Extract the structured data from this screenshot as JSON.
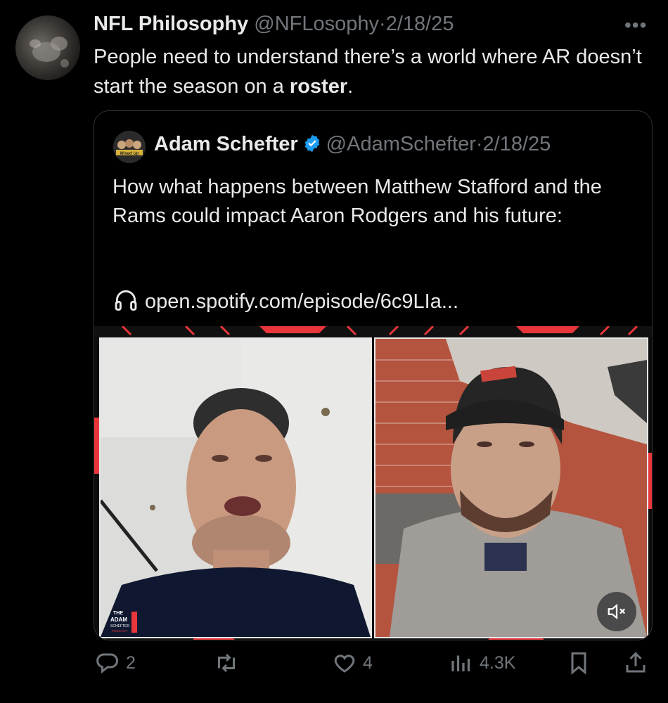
{
  "post": {
    "author_name": "NFL Philosophy",
    "handle": "@NFLosophy",
    "separator": "·",
    "date": "2/18/25",
    "text_pre": "People need to understand there’s a world where AR doesn’t start the season on a ",
    "text_bold": "roster",
    "text_post": "."
  },
  "quote": {
    "author_name": "Adam Schefter",
    "handle": "@AdamSchefter",
    "separator": "·",
    "date": "2/18/25",
    "text": "How what happens between Matthew Stafford and the Rams could impact Aaron Rodgers and his future:",
    "link": "open.spotify.com/episode/6c9LIa...",
    "avatar_text": "Mixed Up",
    "podcast_logo_lines": [
      "THE",
      "ADAM",
      "SCHEFTER",
      "PODCAST"
    ]
  },
  "actions": {
    "replies": "2",
    "reposts": "",
    "likes": "4",
    "views": "4.3K"
  },
  "colors": {
    "background": "#000000",
    "text": "#e7e9ea",
    "muted": "#71767b",
    "verified": "#1d9bf0",
    "accent_red": "#e8363b"
  },
  "icons": [
    "more-icon",
    "verified-badge-icon",
    "headphones-icon",
    "mute-icon",
    "reply-icon",
    "repost-icon",
    "like-icon",
    "views-icon",
    "bookmark-icon",
    "share-icon"
  ]
}
